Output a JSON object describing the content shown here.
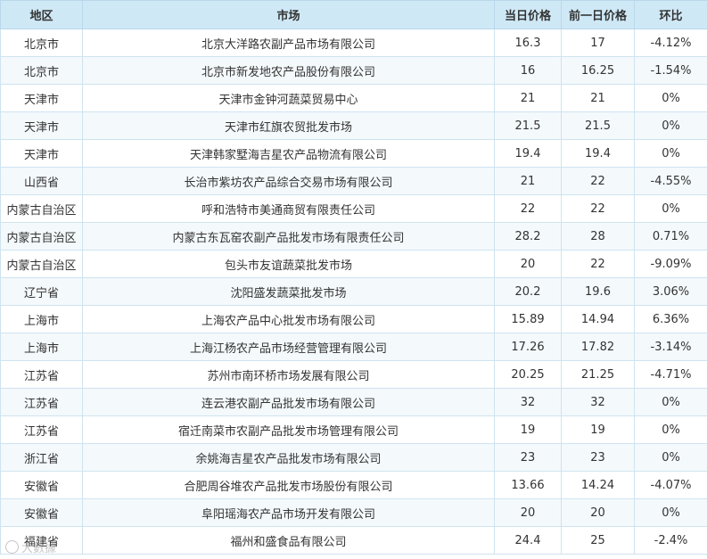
{
  "table": {
    "headers": [
      "地区",
      "市场",
      "当日价格",
      "前一日价格",
      "环比"
    ],
    "rows": [
      [
        "北京市",
        "北京大洋路农副产品市场有限公司",
        "16.3",
        "17",
        "-4.12%"
      ],
      [
        "北京市",
        "北京市新发地农产品股份有限公司",
        "16",
        "16.25",
        "-1.54%"
      ],
      [
        "天津市",
        "天津市金钟河蔬菜贸易中心",
        "21",
        "21",
        "0%"
      ],
      [
        "天津市",
        "天津市红旗农贸批发市场",
        "21.5",
        "21.5",
        "0%"
      ],
      [
        "天津市",
        "天津韩家墅海吉星农产品物流有限公司",
        "19.4",
        "19.4",
        "0%"
      ],
      [
        "山西省",
        "长治市紫坊农产品综合交易市场有限公司",
        "21",
        "22",
        "-4.55%"
      ],
      [
        "内蒙古自治区",
        "呼和浩特市美通商贸有限责任公司",
        "22",
        "22",
        "0%"
      ],
      [
        "内蒙古自治区",
        "内蒙古东瓦窑农副产品批发市场有限责任公司",
        "28.2",
        "28",
        "0.71%"
      ],
      [
        "内蒙古自治区",
        "包头市友谊蔬菜批发市场",
        "20",
        "22",
        "-9.09%"
      ],
      [
        "辽宁省",
        "沈阳盛发蔬菜批发市场",
        "20.2",
        "19.6",
        "3.06%"
      ],
      [
        "上海市",
        "上海农产品中心批发市场有限公司",
        "15.89",
        "14.94",
        "6.36%"
      ],
      [
        "上海市",
        "上海江杨农产品市场经营管理有限公司",
        "17.26",
        "17.82",
        "-3.14%"
      ],
      [
        "江苏省",
        "苏州市南环桥市场发展有限公司",
        "20.25",
        "21.25",
        "-4.71%"
      ],
      [
        "江苏省",
        "连云港农副产品批发市场有限公司",
        "32",
        "32",
        "0%"
      ],
      [
        "江苏省",
        "宿迁南菜市农副产品批发市场管理有限公司",
        "19",
        "19",
        "0%"
      ],
      [
        "浙江省",
        "余姚海吉星农产品批发市场有限公司",
        "23",
        "23",
        "0%"
      ],
      [
        "安徽省",
        "合肥周谷堆农产品批发市场股份有限公司",
        "13.66",
        "14.24",
        "-4.07%"
      ],
      [
        "安徽省",
        "阜阳瑶海农产品市场开发有限公司",
        "20",
        "20",
        "0%"
      ],
      [
        "福建省",
        "福州和盛食品有限公司",
        "24.4",
        "25",
        "-2.4%"
      ]
    ]
  },
  "watermark": {
    "text": "大數據",
    "icon": "logo-circle-icon"
  }
}
